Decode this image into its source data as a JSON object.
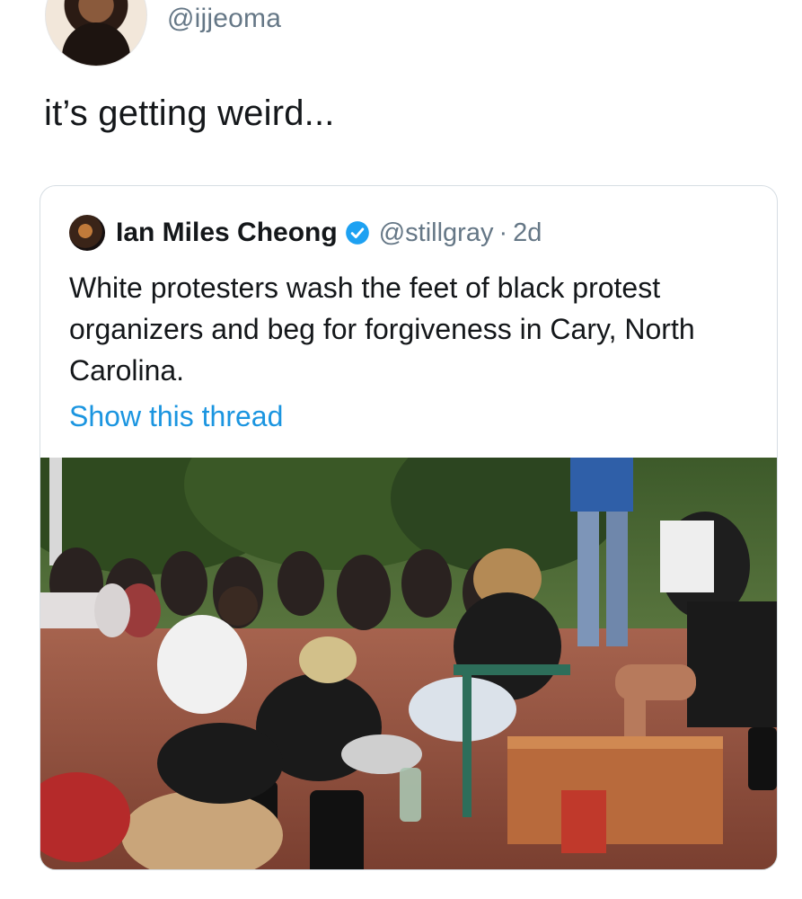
{
  "tweet": {
    "handle": "@ijjeoma",
    "text": "it’s getting weird..."
  },
  "quoted_tweet": {
    "display_name": "Ian Miles Cheong",
    "handle": "@stillgray",
    "separator": "·",
    "time": "2d",
    "text": "White protesters wash the feet of black protest organizers and beg for forgiveness in Cary, North Carolina.",
    "thread_link": "Show this thread",
    "image_alt": "photo"
  },
  "colors": {
    "link": "#1b95e0",
    "secondary_text": "#657786",
    "verified": "#1da1f2"
  },
  "icons": {
    "verified": "verified-badge-icon"
  }
}
